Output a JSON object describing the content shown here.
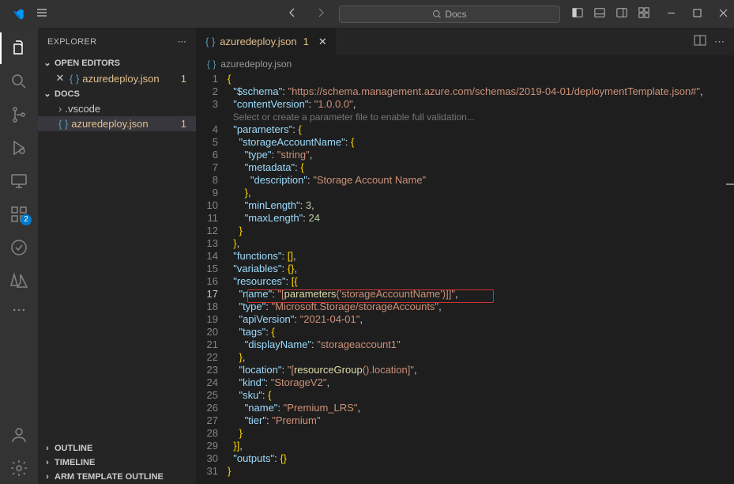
{
  "titlebar": {
    "search_placeholder": "Docs"
  },
  "activitybar": {
    "ext_badge": "2"
  },
  "sidebar": {
    "title": "EXPLORER",
    "sections": {
      "open_editors": "OPEN EDITORS",
      "docs": "DOCS",
      "outline": "OUTLINE",
      "timeline": "TIMELINE",
      "arm": "ARM TEMPLATE OUTLINE"
    },
    "open_items": [
      {
        "name": "azuredeploy.json",
        "modified": true,
        "badge": "1"
      }
    ],
    "tree": [
      {
        "name": ".vscode",
        "kind": "folder"
      },
      {
        "name": "azuredeploy.json",
        "kind": "file",
        "modified": true,
        "badge": "1",
        "selected": true
      }
    ]
  },
  "editor": {
    "tab_name": "azuredeploy.json",
    "tab_badge": "1",
    "crumb": "azuredeploy.json",
    "hint": "Select or create a parameter file to enable full validation...",
    "lines": [
      {
        "n": 1,
        "i": 0,
        "t": [
          {
            "c": "br",
            "v": "{"
          }
        ]
      },
      {
        "n": 2,
        "i": 1,
        "t": [
          {
            "c": "k",
            "v": "\"$schema\""
          },
          {
            "c": "p",
            "v": ": "
          },
          {
            "c": "s",
            "v": "\"https://schema.management.azure.com/schemas/2019-04-01/deploymentTemplate.json#\""
          },
          {
            "c": "p",
            "v": ","
          }
        ]
      },
      {
        "n": 3,
        "i": 1,
        "t": [
          {
            "c": "k",
            "v": "\"contentVersion\""
          },
          {
            "c": "p",
            "v": ": "
          },
          {
            "c": "s",
            "v": "\"1.0.0.0\""
          },
          {
            "c": "p",
            "v": ","
          }
        ]
      },
      {
        "n": 4,
        "i": 1,
        "t": [
          {
            "c": "k",
            "v": "\"parameters\""
          },
          {
            "c": "p",
            "v": ": "
          },
          {
            "c": "br",
            "v": "{"
          }
        ]
      },
      {
        "n": 5,
        "i": 2,
        "t": [
          {
            "c": "k",
            "v": "\"storageAccountName\""
          },
          {
            "c": "p",
            "v": ": "
          },
          {
            "c": "br",
            "v": "{"
          }
        ]
      },
      {
        "n": 6,
        "i": 3,
        "t": [
          {
            "c": "k",
            "v": "\"type\""
          },
          {
            "c": "p",
            "v": ": "
          },
          {
            "c": "s",
            "v": "\"string\""
          },
          {
            "c": "p",
            "v": ","
          }
        ]
      },
      {
        "n": 7,
        "i": 3,
        "t": [
          {
            "c": "k",
            "v": "\"metadata\""
          },
          {
            "c": "p",
            "v": ": "
          },
          {
            "c": "br",
            "v": "{"
          }
        ]
      },
      {
        "n": 8,
        "i": 4,
        "t": [
          {
            "c": "k",
            "v": "\"description\""
          },
          {
            "c": "p",
            "v": ": "
          },
          {
            "c": "s",
            "v": "\"Storage Account Name\""
          }
        ]
      },
      {
        "n": 9,
        "i": 3,
        "t": [
          {
            "c": "br",
            "v": "}"
          },
          {
            "c": "p",
            "v": ","
          }
        ]
      },
      {
        "n": 10,
        "i": 3,
        "t": [
          {
            "c": "k",
            "v": "\"minLength\""
          },
          {
            "c": "p",
            "v": ": "
          },
          {
            "c": "n",
            "v": "3"
          },
          {
            "c": "p",
            "v": ","
          }
        ]
      },
      {
        "n": 11,
        "i": 3,
        "t": [
          {
            "c": "k",
            "v": "\"maxLength\""
          },
          {
            "c": "p",
            "v": ": "
          },
          {
            "c": "n",
            "v": "24"
          }
        ]
      },
      {
        "n": 12,
        "i": 2,
        "t": [
          {
            "c": "br",
            "v": "}"
          }
        ]
      },
      {
        "n": 13,
        "i": 1,
        "t": [
          {
            "c": "br",
            "v": "}"
          },
          {
            "c": "p",
            "v": ","
          }
        ]
      },
      {
        "n": 14,
        "i": 1,
        "t": [
          {
            "c": "k",
            "v": "\"functions\""
          },
          {
            "c": "p",
            "v": ": "
          },
          {
            "c": "br",
            "v": "[]"
          },
          {
            "c": "p",
            "v": ","
          }
        ]
      },
      {
        "n": 15,
        "i": 1,
        "t": [
          {
            "c": "k",
            "v": "\"variables\""
          },
          {
            "c": "p",
            "v": ": "
          },
          {
            "c": "br",
            "v": "{}"
          },
          {
            "c": "p",
            "v": ","
          }
        ]
      },
      {
        "n": 16,
        "i": 1,
        "t": [
          {
            "c": "k",
            "v": "\"resources\""
          },
          {
            "c": "p",
            "v": ": "
          },
          {
            "c": "br",
            "v": "[{"
          }
        ]
      },
      {
        "n": 17,
        "i": 2,
        "t": [
          {
            "c": "k",
            "v": "\"name\""
          },
          {
            "c": "p",
            "v": ": "
          },
          {
            "c": "s",
            "v": "\"["
          },
          {
            "c": "fn",
            "v": "parameters"
          },
          {
            "c": "s",
            "v": "("
          },
          {
            "c": "s",
            "v": "'storageAccountName'"
          },
          {
            "c": "s",
            "v": ")]"
          },
          {
            "c": "s",
            "v": "]\""
          },
          {
            "c": "p",
            "v": ","
          }
        ]
      },
      {
        "n": 18,
        "i": 2,
        "t": [
          {
            "c": "k",
            "v": "\"type\""
          },
          {
            "c": "p",
            "v": ": "
          },
          {
            "c": "s",
            "v": "\"Microsoft.Storage/storageAccounts\""
          },
          {
            "c": "p",
            "v": ","
          }
        ]
      },
      {
        "n": 19,
        "i": 2,
        "t": [
          {
            "c": "k",
            "v": "\"apiVersion\""
          },
          {
            "c": "p",
            "v": ": "
          },
          {
            "c": "s",
            "v": "\"2021-04-01\""
          },
          {
            "c": "p",
            "v": ","
          }
        ]
      },
      {
        "n": 20,
        "i": 2,
        "t": [
          {
            "c": "k",
            "v": "\"tags\""
          },
          {
            "c": "p",
            "v": ": "
          },
          {
            "c": "br",
            "v": "{"
          }
        ]
      },
      {
        "n": 21,
        "i": 3,
        "t": [
          {
            "c": "k",
            "v": "\"displayName\""
          },
          {
            "c": "p",
            "v": ": "
          },
          {
            "c": "s",
            "v": "\"storageaccount1\""
          }
        ]
      },
      {
        "n": 22,
        "i": 2,
        "t": [
          {
            "c": "br",
            "v": "}"
          },
          {
            "c": "p",
            "v": ","
          }
        ]
      },
      {
        "n": 23,
        "i": 2,
        "t": [
          {
            "c": "k",
            "v": "\"location\""
          },
          {
            "c": "p",
            "v": ": "
          },
          {
            "c": "s",
            "v": "\"["
          },
          {
            "c": "fn",
            "v": "resourceGroup"
          },
          {
            "c": "s",
            "v": "().location]\""
          },
          {
            "c": "p",
            "v": ","
          }
        ]
      },
      {
        "n": 24,
        "i": 2,
        "t": [
          {
            "c": "k",
            "v": "\"kind\""
          },
          {
            "c": "p",
            "v": ": "
          },
          {
            "c": "s",
            "v": "\"StorageV2\""
          },
          {
            "c": "p",
            "v": ","
          }
        ]
      },
      {
        "n": 25,
        "i": 2,
        "t": [
          {
            "c": "k",
            "v": "\"sku\""
          },
          {
            "c": "p",
            "v": ": "
          },
          {
            "c": "br",
            "v": "{"
          }
        ]
      },
      {
        "n": 26,
        "i": 3,
        "t": [
          {
            "c": "k",
            "v": "\"name\""
          },
          {
            "c": "p",
            "v": ": "
          },
          {
            "c": "s",
            "v": "\"Premium_LRS\""
          },
          {
            "c": "p",
            "v": ","
          }
        ]
      },
      {
        "n": 27,
        "i": 3,
        "t": [
          {
            "c": "k",
            "v": "\"tier\""
          },
          {
            "c": "p",
            "v": ": "
          },
          {
            "c": "s",
            "v": "\"Premium\""
          }
        ]
      },
      {
        "n": 28,
        "i": 2,
        "t": [
          {
            "c": "br",
            "v": "}"
          }
        ]
      },
      {
        "n": 29,
        "i": 1,
        "t": [
          {
            "c": "br",
            "v": "}]"
          },
          {
            "c": "p",
            "v": ","
          }
        ]
      },
      {
        "n": 30,
        "i": 1,
        "t": [
          {
            "c": "k",
            "v": "\"outputs\""
          },
          {
            "c": "p",
            "v": ": "
          },
          {
            "c": "br",
            "v": "{}"
          }
        ]
      },
      {
        "n": 31,
        "i": 0,
        "t": [
          {
            "c": "br",
            "v": "}"
          }
        ]
      }
    ]
  }
}
